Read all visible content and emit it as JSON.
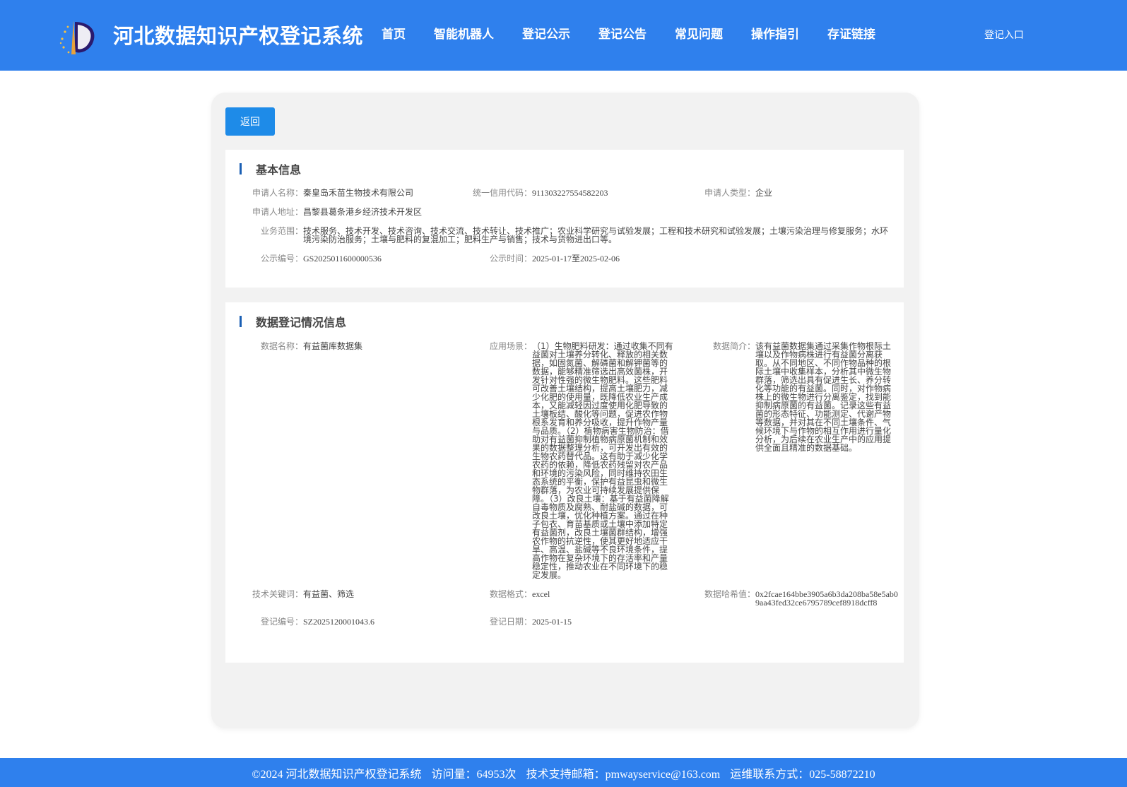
{
  "header": {
    "title": "河北数据知识产权登记系统",
    "nav": [
      "首页",
      "智能机器人",
      "登记公示",
      "登记公告",
      "常见问题",
      "操作指引",
      "存证链接"
    ],
    "login": "登记入口"
  },
  "main": {
    "back_label": "返回",
    "basic": {
      "title": "基本信息",
      "applicant_name_label": "申请人名称：",
      "applicant_name": "秦皇岛禾苗生物技术有限公司",
      "credit_code_label": "统一信用代码：",
      "credit_code": "911303227554582203",
      "applicant_type_label": "申请人类型：",
      "applicant_type": "企业",
      "address_label": "申请人地址：",
      "address": "昌黎县葛条港乡经济技术开发区",
      "scope_label": "业务范围：",
      "scope": "技术服务、技术开发、技术咨询、技术交流、技术转让、技术推广；农业科学研究与试验发展；工程和技术研究和试验发展；土壤污染治理与修复服务；水环境污染防治服务；土壤与肥料的复混加工；肥料生产与销售；技术与货物进出口等。",
      "notice_no_label": "公示编号：",
      "notice_no": "GS2025011600000536",
      "notice_time_label": "公示时间：",
      "notice_time": "2025-01-17至2025-02-06"
    },
    "data": {
      "title": "数据登记情况信息",
      "name_label": "数据名称：",
      "name": "有益菌库数据集",
      "scenario_label": "应用场景：",
      "scenario": "（1）生物肥料研发：通过收集不同有益菌对土壤养分转化、释放的相关数据，如固氮菌、解磷菌和解钾菌等的数据，能够精准筛选出高效菌株，开发针对性强的微生物肥料。这些肥料可改善土壤结构，提高土壤肥力，减少化肥的使用量，既降低农业生产成本，又能减轻因过度使用化肥导致的土壤板结、酸化等问题，促进农作物根系发育和养分吸收，提升作物产量与品质。（2）植物病害生物防治：借助对有益菌抑制植物病原菌机制和效果的数据整理分析，可开发出有效的生物农药替代品。这有助于减少化学农药的依赖，降低农药残留对农产品和环境的污染风险，同时维持农田生态系统的平衡，保护有益昆虫和微生物群落，为农业可持续发展提供保障。（3）改良土壤：基于有益菌降解自毒物质及腐熟、耐盐碱的数据，可改良土壤，优化种植方案。通过在种子包衣、育苗基质或土壤中添加特定有益菌剂，改良土壤菌群结构，增强农作物的抗逆性，使其更好地适应干旱、高温、盐碱等不良环境条件，提高作物在复杂环境下的存活率和产量稳定性，推动农业在不同环境下的稳定发展。",
      "intro_label": "数据简介：",
      "intro": "该有益菌数据集通过采集作物根际土壤以及作物病株进行有益菌分离获取。从不同地区、不同作物品种的根际土壤中收集样本，分析其中微生物群落，筛选出具有促进生长、养分转化等功能的有益菌。同时，对作物病株上的微生物进行分离鉴定，找到能抑制病原菌的有益菌。记录这些有益菌的形态特征、功能测定、代谢产物等数据，并对其在不同土壤条件、气候环境下与作物的相互作用进行量化分析，为后续在农业生产中的应用提供全面且精准的数据基础。",
      "keywords_label": "技术关键词：",
      "keywords": "有益菌、筛选",
      "format_label": "数据格式：",
      "format": "excel",
      "hash_label": "数据哈希值：",
      "hash": "0x2fcae164bbe3905a6b3da208ba58e5ab09aa43fed32ce6795789cef8918dcff8",
      "reg_no_label": "登记编号：",
      "reg_no": "SZ2025120001043.6",
      "reg_date_label": "登记日期：",
      "reg_date": "2025-01-15"
    }
  },
  "footer": {
    "copyright": "©2024 河北数据知识产权登记系统",
    "visits": "访问量：64953次",
    "email": "技术支持邮箱：pmwayservice@163.com",
    "contact": "运维联系方式：025-58872210"
  },
  "colors": {
    "header_bg": "#2f80ed",
    "button_bg": "#1e8be8",
    "section_bar": "#1a5fb4"
  }
}
